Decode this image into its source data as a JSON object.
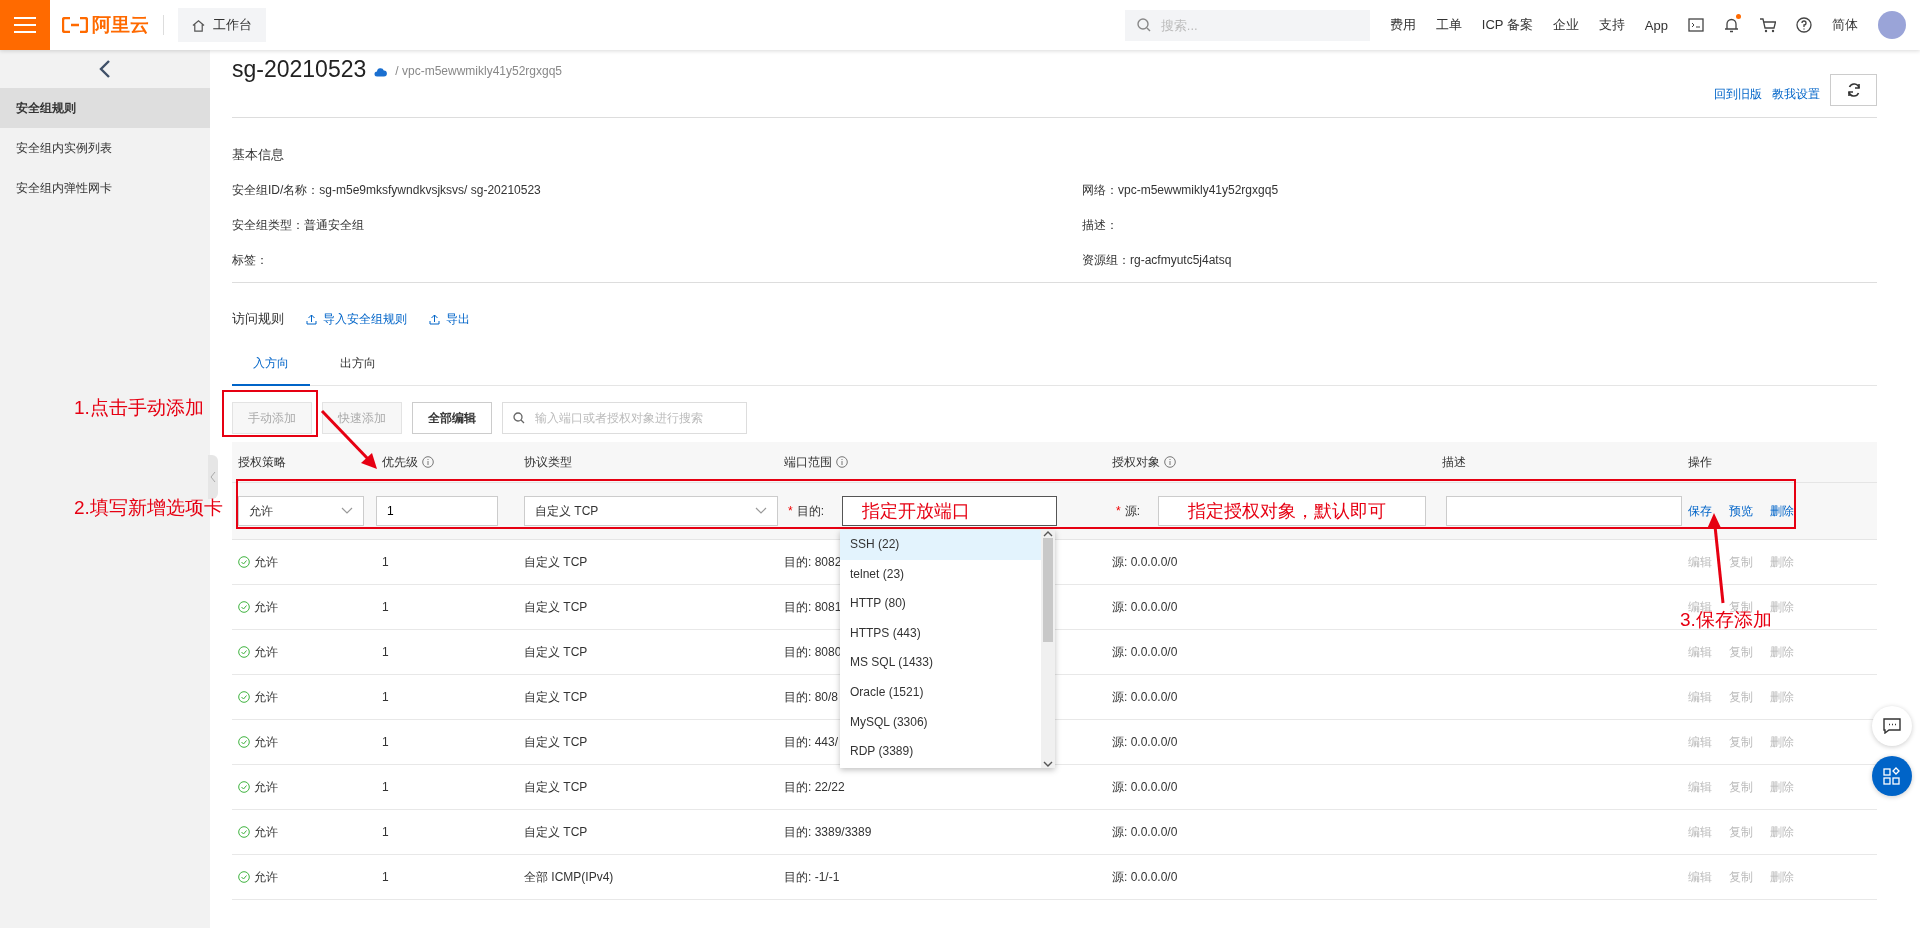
{
  "topbar": {
    "logo": "阿里云",
    "workbench": "工作台",
    "search": {
      "placeholder": "搜索..."
    },
    "links": [
      "费用",
      "工单",
      "ICP 备案",
      "企业",
      "支持",
      "App"
    ],
    "notification_dot": true,
    "language": "简体"
  },
  "sidebar": {
    "items": [
      {
        "label": "安全组规则",
        "selected": true
      },
      {
        "label": "安全组内实例列表",
        "selected": false
      },
      {
        "label": "安全组内弹性网卡",
        "selected": false
      }
    ]
  },
  "header": {
    "title": "sg-20210523",
    "subtitle": "/ vpc-m5ewwmikly41y52rgxgq5",
    "links": [
      "回到旧版",
      "教我设置"
    ]
  },
  "basic_info": {
    "title": "基本信息",
    "fields": [
      {
        "label": "安全组ID/名称：",
        "value": "sg-m5e9mksfywndkvsjksvs/ sg-20210523"
      },
      {
        "label": "网络：",
        "value": "vpc-m5ewwmikly41y52rgxgq5"
      },
      {
        "label": "安全组类型：",
        "value": "普通安全组"
      },
      {
        "label": "描述："
      },
      {
        "label": "标签："
      },
      {
        "label": "资源组：",
        "value": "rg-acfmyutc5j4atsq"
      }
    ]
  },
  "rules": {
    "title": "访问规则",
    "actions": [
      "导入安全组规则",
      "导出"
    ],
    "tabs": [
      {
        "label": "入方向",
        "selected": true
      },
      {
        "label": "出方向",
        "selected": false
      }
    ],
    "toolbar": {
      "buttons": [
        {
          "label": "手动添加",
          "disabled": true
        },
        {
          "label": "快速添加",
          "disabled": true
        },
        {
          "label": "全部编辑",
          "disabled": false
        }
      ],
      "search": {
        "placeholder": "输入端口或者授权对象进行搜索"
      }
    },
    "table": {
      "columns": [
        {
          "label": "授权策略"
        },
        {
          "label": "优先级",
          "info": true
        },
        {
          "label": "协议类型"
        },
        {
          "label": "端口范围",
          "info": true
        },
        {
          "label": "授权对象",
          "info": true
        },
        {
          "label": "描述"
        },
        {
          "label": "操作"
        }
      ],
      "edit_row": {
        "policy": "允许",
        "priority": "1",
        "protocol": "自定义 TCP",
        "port_mark": "*",
        "port_label": "目的:",
        "source_mark": "*",
        "source_label": "源:",
        "actions": [
          "保存",
          "预览",
          "删除"
        ]
      },
      "rows": [
        {
          "policy": "允许",
          "priority": "1",
          "protocol": "自定义 TCP",
          "port": "目的: 8082",
          "source": "源: 0.0.0.0/0",
          "actions": [
            "编辑",
            "复制",
            "删除"
          ],
          "actions_disabled": true
        },
        {
          "policy": "允许",
          "priority": "1",
          "protocol": "自定义 TCP",
          "port": "目的: 8081",
          "source": "源: 0.0.0.0/0",
          "actions": [
            "编辑",
            "复制",
            "删除"
          ],
          "actions_disabled": true
        },
        {
          "policy": "允许",
          "priority": "1",
          "protocol": "自定义 TCP",
          "port": "目的: 8080",
          "source": "源: 0.0.0.0/0",
          "actions": [
            "编辑",
            "复制",
            "删除"
          ],
          "actions_disabled": true
        },
        {
          "policy": "允许",
          "priority": "1",
          "protocol": "自定义 TCP",
          "port": "目的: 80/8",
          "source": "源: 0.0.0.0/0",
          "actions": [
            "编辑",
            "复制",
            "删除"
          ],
          "actions_disabled": true
        },
        {
          "policy": "允许",
          "priority": "1",
          "protocol": "自定义 TCP",
          "port": "目的: 443/",
          "source": "源: 0.0.0.0/0",
          "actions": [
            "编辑",
            "复制",
            "删除"
          ],
          "actions_disabled": true
        },
        {
          "policy": "允许",
          "priority": "1",
          "protocol": "自定义 TCP",
          "port": "目的: 22/22",
          "source": "源: 0.0.0.0/0",
          "actions": [
            "编辑",
            "复制",
            "删除"
          ],
          "actions_disabled": true
        },
        {
          "policy": "允许",
          "priority": "1",
          "protocol": "自定义 TCP",
          "port": "目的: 3389/3389",
          "source": "源: 0.0.0.0/0",
          "actions": [
            "编辑",
            "复制",
            "删除"
          ],
          "actions_disabled": true
        },
        {
          "policy": "允许",
          "priority": "1",
          "protocol": "全部 ICMP(IPv4)",
          "port": "目的: -1/-1",
          "source": "源: 0.0.0.0/0",
          "actions": [
            "编辑",
            "复制",
            "删除"
          ],
          "actions_disabled": true
        }
      ]
    },
    "port_dropdown": {
      "options": [
        {
          "label": "SSH (22)",
          "selected": true
        },
        {
          "label": "telnet (23)",
          "selected": false
        },
        {
          "label": "HTTP (80)",
          "selected": false
        },
        {
          "label": "HTTPS (443)",
          "selected": false
        },
        {
          "label": "MS SQL (1433)",
          "selected": false
        },
        {
          "label": "Oracle (1521)",
          "selected": false
        },
        {
          "label": "MySQL (3306)",
          "selected": false
        },
        {
          "label": "RDP (3389)",
          "selected": false
        }
      ]
    }
  },
  "annotations": [
    {
      "kind": "step",
      "text": "1.点击手动添加"
    },
    {
      "kind": "step",
      "text": "2.填写新增选项卡"
    },
    {
      "kind": "hint",
      "text": "指定开放端口"
    },
    {
      "kind": "hint",
      "text": "指定授权对象，默认即可"
    },
    {
      "kind": "step",
      "text": "3.保存添加"
    }
  ]
}
